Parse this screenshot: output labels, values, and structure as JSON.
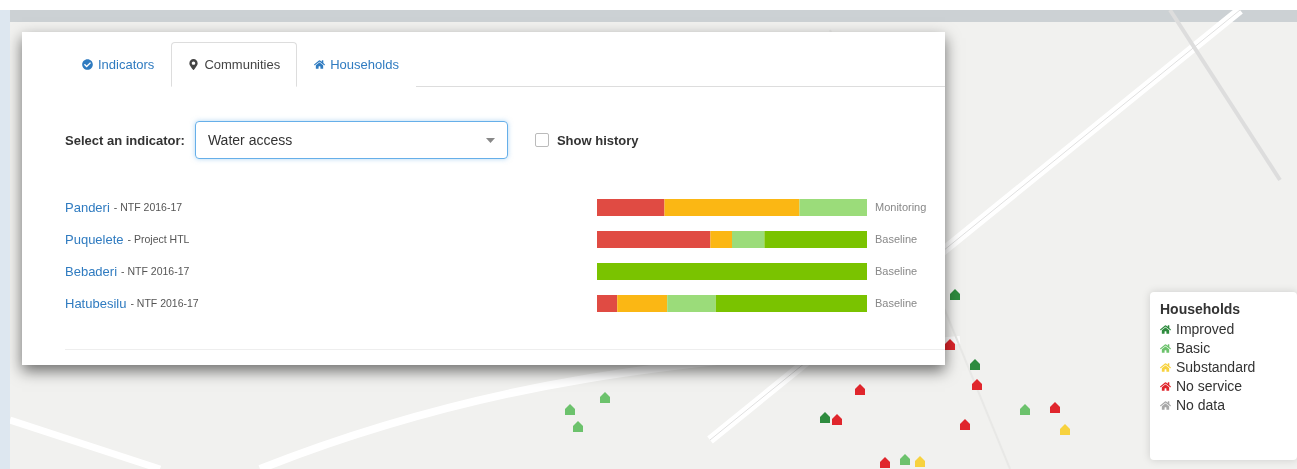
{
  "tabs": [
    {
      "label": "Indicators",
      "selected": false
    },
    {
      "label": "Communities",
      "selected": true
    },
    {
      "label": "Households",
      "selected": false
    }
  ],
  "indicator_select": {
    "label": "Select an indicator:",
    "value": "Water access"
  },
  "show_history": {
    "label": "Show history",
    "checked": false
  },
  "communities": [
    {
      "name": "Panderi",
      "project": "- NTF 2016-17",
      "status": "Monitoring"
    },
    {
      "name": "Puquelete",
      "project": "- Project HTL",
      "status": "Baseline"
    },
    {
      "name": "Bebaderi",
      "project": "- NTF 2016-17",
      "status": "Baseline"
    },
    {
      "name": "Hatubesilu",
      "project": "- NTF 2016-17",
      "status": "Baseline"
    }
  ],
  "legend": {
    "title": "Households",
    "items": [
      {
        "label": "Improved",
        "color": "#2e8b3e"
      },
      {
        "label": "Basic",
        "color": "#6cc26c"
      },
      {
        "label": "Substandard",
        "color": "#f7d23e"
      },
      {
        "label": "No service",
        "color": "#e0262c"
      },
      {
        "label": "No data",
        "color": "#a8a8a8"
      }
    ]
  }
}
